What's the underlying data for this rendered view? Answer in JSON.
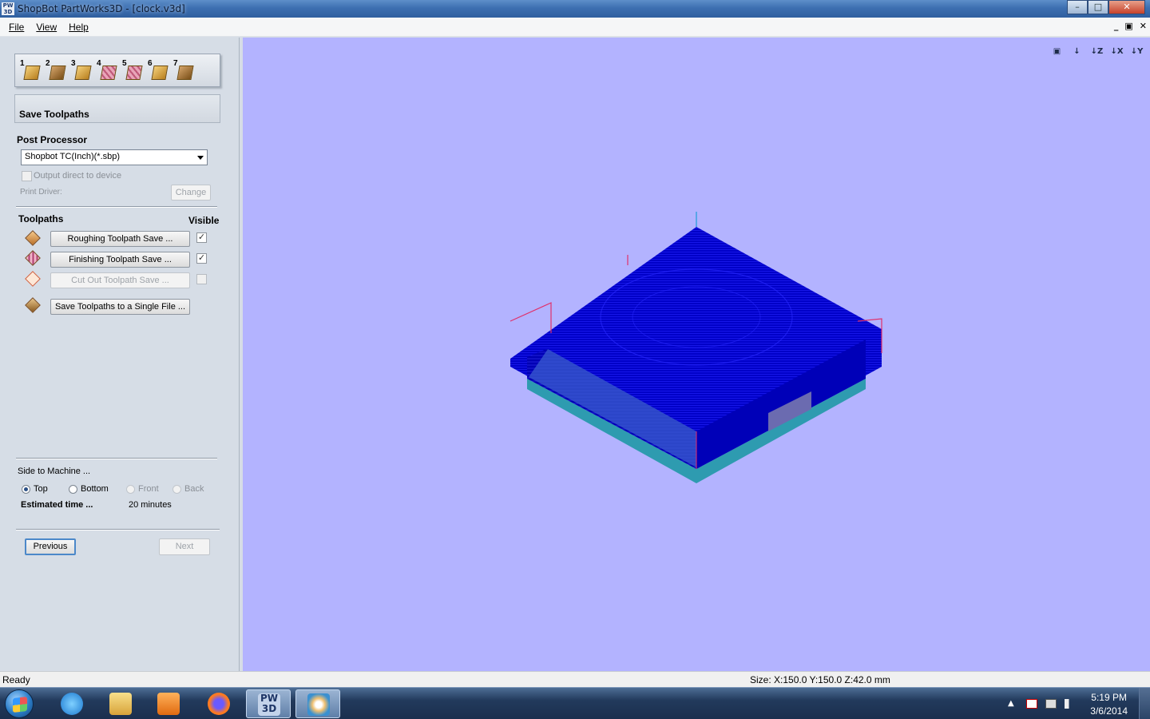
{
  "window": {
    "app_icon": "PW\n3D",
    "title": "ShopBot PartWorks3D - [clock.v3d]",
    "minimize": "–",
    "maximize": "□",
    "close": "✕"
  },
  "menu": {
    "items": [
      "File",
      "View",
      "Help"
    ],
    "mdi": [
      "_",
      "▣",
      "✕"
    ]
  },
  "steps": [
    "1",
    "2",
    "3",
    "4",
    "5",
    "6",
    "7"
  ],
  "panel": {
    "heading": "Save Toolpaths",
    "post_processor_label": "Post Processor",
    "post_processor_value": "Shopbot TC(Inch)(*.sbp)",
    "output_direct_label": "Output direct to device",
    "print_driver_label": "Print Driver:",
    "change_button": "Change",
    "toolpaths_label": "Toolpaths",
    "visible_label": "Visible",
    "toolpaths": [
      {
        "label": "Roughing Toolpath Save ...",
        "visible": true,
        "enabled": true
      },
      {
        "label": "Finishing Toolpath Save ...",
        "visible": true,
        "enabled": true
      },
      {
        "label": "Cut Out Toolpath Save ...",
        "visible": false,
        "enabled": false
      }
    ],
    "save_single_button": "Save Toolpaths to a Single File ...",
    "side_label": "Side to Machine ...",
    "sides": [
      {
        "label": "Top",
        "selected": true,
        "enabled": true
      },
      {
        "label": "Bottom",
        "selected": false,
        "enabled": true
      },
      {
        "label": "Front",
        "selected": false,
        "enabled": false
      },
      {
        "label": "Back",
        "selected": false,
        "enabled": false
      }
    ],
    "estimated_label": "Estimated time ...",
    "estimated_value": "20 minutes",
    "previous_button": "Previous",
    "next_button": "Next"
  },
  "view_tools": [
    "▣",
    "↓",
    "↓Z",
    "↓X",
    "↓Y"
  ],
  "colors": {
    "viewport_bg": "#b3b3ff",
    "toolpath_blue": "#0000c8",
    "material_teal": "#2e9bb0",
    "boundary_red": "#e0306a"
  },
  "status": {
    "left": "Ready",
    "size": "Size: X:150.0 Y:150.0 Z:42.0 mm"
  },
  "taskbar": {
    "pw3d_label": "PW\n3D",
    "tray_arrow": "▲",
    "time": "5:19 PM",
    "date": "3/6/2014"
  }
}
